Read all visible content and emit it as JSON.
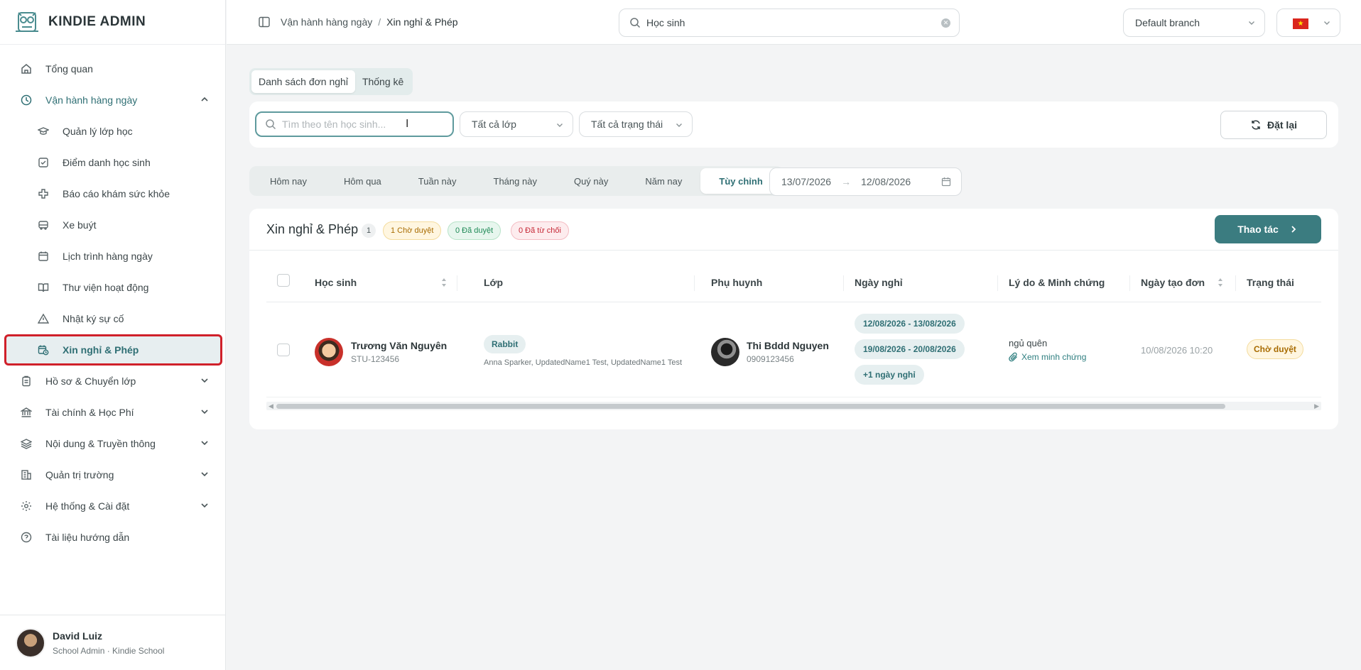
{
  "app": {
    "name": "KINDIE ADMIN"
  },
  "sidebar": {
    "items": [
      {
        "label": "Tổng quan"
      },
      {
        "label": "Vận hành hàng ngày"
      },
      {
        "label": "Hồ sơ & Chuyển lớp"
      },
      {
        "label": "Tài chính & Học Phí"
      },
      {
        "label": "Nội dung & Truyền thông"
      },
      {
        "label": "Quản trị trường"
      },
      {
        "label": "Hệ thống & Cài đặt"
      },
      {
        "label": "Tài liệu hướng dẫn"
      }
    ],
    "subitems": [
      {
        "label": "Quản lý lớp học"
      },
      {
        "label": "Điểm danh học sinh"
      },
      {
        "label": "Báo cáo khám sức khỏe"
      },
      {
        "label": "Xe buýt"
      },
      {
        "label": "Lịch trình hàng ngày"
      },
      {
        "label": "Thư viện hoạt động"
      },
      {
        "label": "Nhật ký sự cố"
      },
      {
        "label": "Xin nghỉ & Phép"
      }
    ]
  },
  "user": {
    "name": "David Luiz",
    "role": "School Admin · Kindie School"
  },
  "header": {
    "breadcrumb": [
      "Vận hành hàng ngày",
      "Xin nghỉ & Phép"
    ],
    "breadcrumb_sep": "/",
    "search_value": "Học sinh",
    "branch": "Default branch"
  },
  "tabs": [
    "Danh sách đơn nghỉ",
    "Thống kê"
  ],
  "filters": {
    "search_placeholder": "Tìm theo tên học sinh...",
    "class_select": "Tất cả lớp",
    "status_select": "Tất cả trạng thái",
    "reset_label": "Đặt lại"
  },
  "periods": [
    "Hôm nay",
    "Hôm qua",
    "Tuần này",
    "Tháng này",
    "Quý này",
    "Năm nay",
    "Tùy chỉnh"
  ],
  "date_range": {
    "from": "13/07/2026",
    "arrow": "→",
    "to": "12/08/2026"
  },
  "card": {
    "title": "Xin nghỉ & Phép",
    "count": "1",
    "pending": "1 Chờ duyệt",
    "approved": "0 Đã duyệt",
    "rejected": "0 Đã từ chối",
    "action_label": "Thao tác"
  },
  "table": {
    "columns": [
      "Học sinh",
      "Lớp",
      "Phụ huynh",
      "Ngày nghỉ",
      "Lý do & Minh chứng",
      "Ngày tạo đơn",
      "Trạng thái"
    ],
    "rows": [
      {
        "student_name": "Trương Văn Nguyên",
        "student_id": "STU-123456",
        "class": "Rabbit",
        "teachers": "Anna Sparker, UpdatedName1 Test, UpdatedName1 Test",
        "parent_name": "Thi Bddd Nguyen",
        "parent_phone": "0909123456",
        "dates": [
          "12/08/2026 - 13/08/2026",
          "19/08/2026 - 20/08/2026",
          "+1 ngày nghỉ"
        ],
        "reason": "ngủ quên",
        "evidence": "Xem minh chứng",
        "created": "10/08/2026 10:20",
        "status": "Chờ duyệt"
      }
    ]
  },
  "colors": {
    "accent": "#3b7c80",
    "active_border": "#d0202a"
  }
}
